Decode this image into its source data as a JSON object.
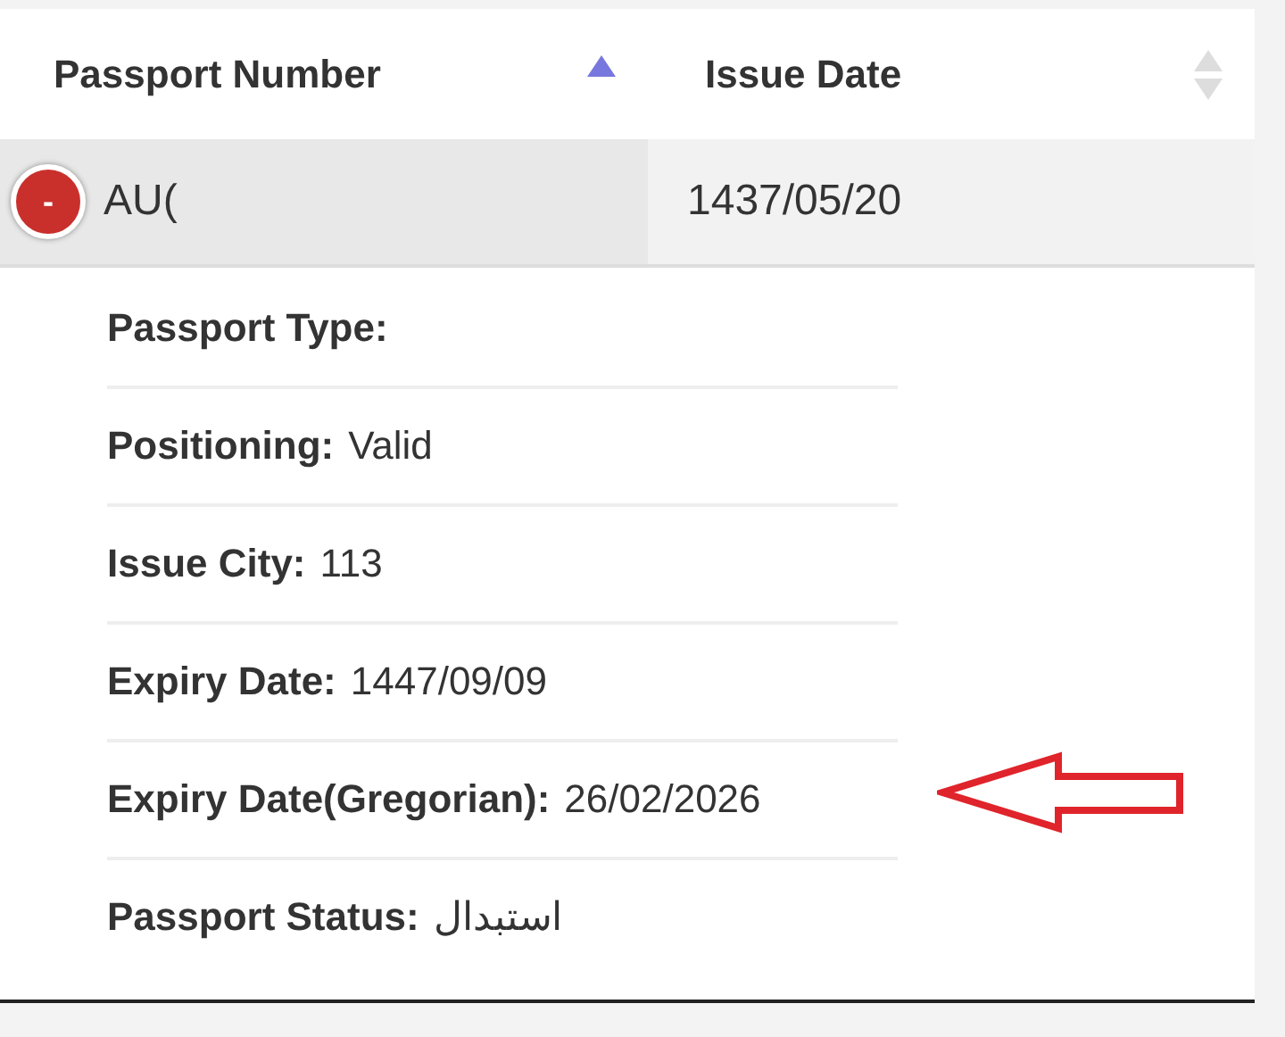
{
  "table": {
    "columns": [
      {
        "label": "Passport Number",
        "sorted": true
      },
      {
        "label": "Issue Date",
        "sorted": false
      }
    ],
    "rows": [
      {
        "expanded": true,
        "toggle": "-",
        "cells": [
          "AU(",
          "1437/05/20"
        ],
        "details": [
          {
            "label": "Passport Type:"
          },
          {
            "label": "Positioning:",
            "value": "Valid"
          },
          {
            "label": "Issue City:",
            "value": "113"
          },
          {
            "label": "Expiry Date:",
            "value": "1447/09/09"
          },
          {
            "label": "Expiry Date(Gregorian):",
            "value": "26/02/2026"
          },
          {
            "label": "Passport Status:",
            "value": "استبدال"
          }
        ]
      }
    ]
  }
}
